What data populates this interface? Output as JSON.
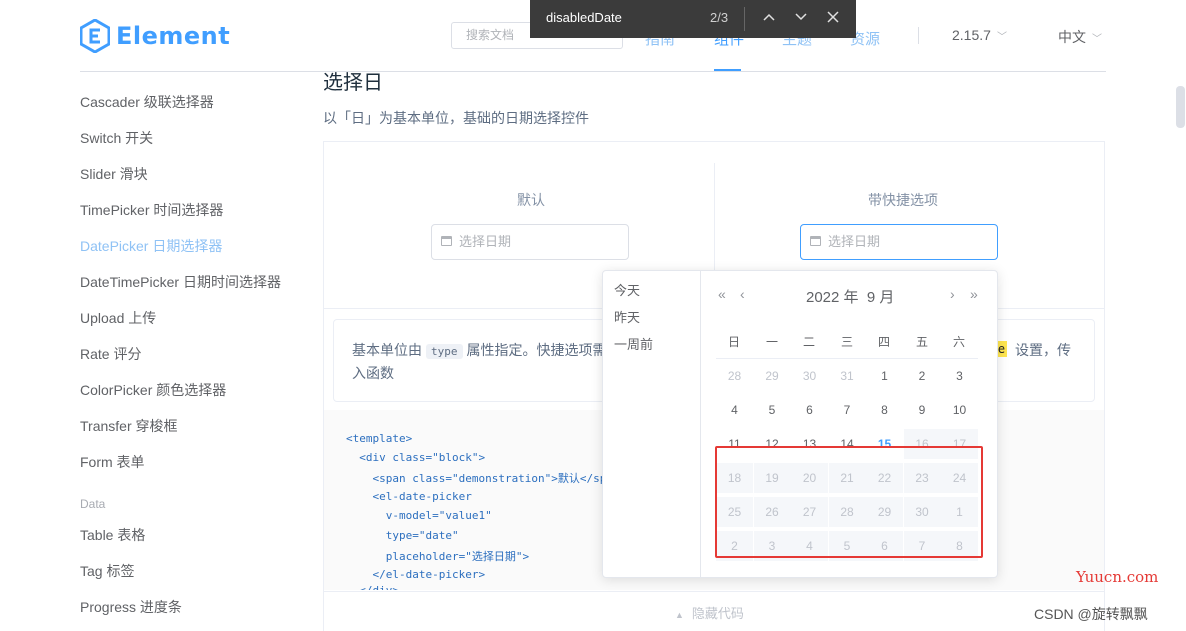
{
  "header": {
    "logo_text": "Element",
    "search_placeholder": "搜索文档",
    "nav": [
      "指南",
      "组件",
      "主题",
      "资源"
    ],
    "version": "2.15.7",
    "language": "中文"
  },
  "find_bar": {
    "query": "disabledDate",
    "count": "2/3"
  },
  "sidebar": {
    "items": [
      "Cascader 级联选择器",
      "Switch 开关",
      "Slider 滑块",
      "TimePicker 时间选择器",
      "DatePicker 日期选择器",
      "DateTimePicker 日期时间选择器",
      "Upload 上传",
      "Rate 评分",
      "ColorPicker 颜色选择器",
      "Transfer 穿梭框",
      "Form 表单"
    ],
    "group": "Data",
    "data_items": [
      "Table 表格",
      "Tag 标签",
      "Progress 进度条"
    ]
  },
  "content": {
    "title": "选择日",
    "desc": "以「日」为基本单位，基础的日期选择控件",
    "demo_default_label": "默认",
    "demo_shortcut_label": "带快捷选项",
    "placeholder": "选择日期",
    "tip_prefix": "基本单位由",
    "tip_code": "type",
    "tip_rest": "属性指定。快捷选项需配置",
    "tip_tail": "设置，传",
    "tip_line2": "入函数",
    "tip_hl": "e",
    "code_lines": [
      "<template>",
      "  <div class=\"block\">",
      "    <span class=\"demonstration\">默认</span>",
      "    <el-date-picker",
      "      v-model=\"value1\"",
      "      type=\"date\"",
      "      placeholder=\"选择日期\">",
      "    </el-date-picker>",
      "  </div>"
    ],
    "hide_code": "隐藏代码"
  },
  "picker": {
    "shortcuts": [
      "今天",
      "昨天",
      "一周前"
    ],
    "year": "2022 年",
    "month": "9 月",
    "weekdays": [
      "日",
      "一",
      "二",
      "三",
      "四",
      "五",
      "六"
    ],
    "weeks": [
      [
        [
          "28",
          "prev"
        ],
        [
          "29",
          "prev"
        ],
        [
          "30",
          "prev"
        ],
        [
          "31",
          "prev"
        ],
        [
          "1",
          "cur"
        ],
        [
          "2",
          "cur"
        ],
        [
          "3",
          "cur"
        ]
      ],
      [
        [
          "4",
          "cur"
        ],
        [
          "5",
          "cur"
        ],
        [
          "6",
          "cur"
        ],
        [
          "7",
          "cur"
        ],
        [
          "8",
          "cur"
        ],
        [
          "9",
          "cur"
        ],
        [
          "10",
          "cur"
        ]
      ],
      [
        [
          "11",
          "cur"
        ],
        [
          "12",
          "cur"
        ],
        [
          "13",
          "cur"
        ],
        [
          "14",
          "cur"
        ],
        [
          "15",
          "today"
        ],
        [
          "16",
          "dis"
        ],
        [
          "17",
          "dis"
        ]
      ],
      [
        [
          "18",
          "dis"
        ],
        [
          "19",
          "dis"
        ],
        [
          "20",
          "dis"
        ],
        [
          "21",
          "dis"
        ],
        [
          "22",
          "dis"
        ],
        [
          "23",
          "dis"
        ],
        [
          "24",
          "dis"
        ]
      ],
      [
        [
          "25",
          "dis"
        ],
        [
          "26",
          "dis"
        ],
        [
          "27",
          "dis"
        ],
        [
          "28",
          "dis"
        ],
        [
          "29",
          "dis"
        ],
        [
          "30",
          "dis"
        ],
        [
          "1",
          "dis"
        ]
      ],
      [
        [
          "2",
          "dis"
        ],
        [
          "3",
          "dis"
        ],
        [
          "4",
          "dis"
        ],
        [
          "5",
          "dis"
        ],
        [
          "6",
          "dis"
        ],
        [
          "7",
          "dis"
        ],
        [
          "8",
          "dis"
        ]
      ]
    ]
  },
  "watermark": {
    "site": "Yuucn.com",
    "author": "CSDN @旋转飘飘"
  }
}
